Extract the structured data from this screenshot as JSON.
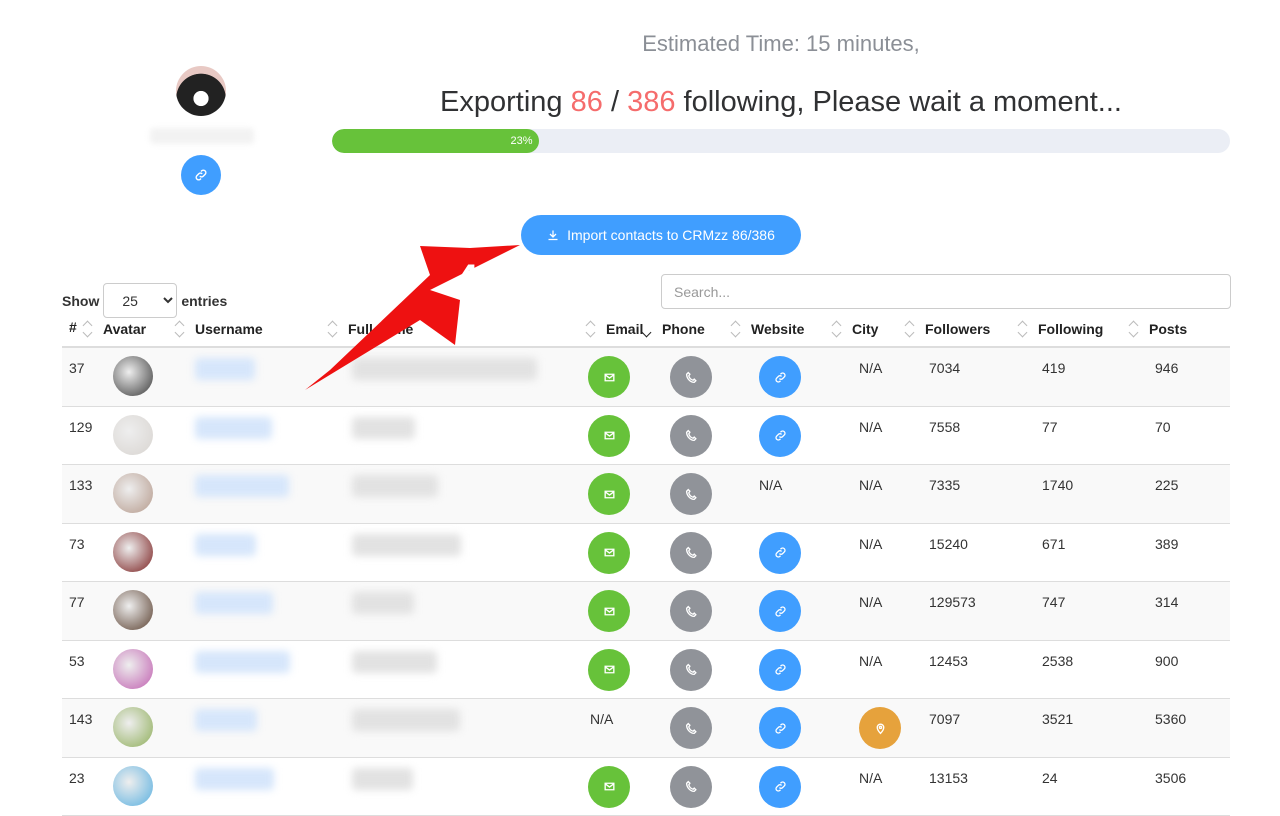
{
  "header": {
    "estimated_time": "Estimated Time: 15 minutes,",
    "exporting_prefix": "Exporting",
    "current": "86",
    "sep": "/",
    "total": "386",
    "exporting_suffix": "following, Please wait a moment...",
    "progress_percent": 23,
    "progress_label": "23%"
  },
  "import_button": {
    "label": "Import contacts to CRMzz 86/386",
    "icon": "download-icon"
  },
  "annotation": {
    "step": "4"
  },
  "controls": {
    "show_label": "Show",
    "entries_value": "25",
    "entries_label": "entries",
    "search_placeholder": "Search..."
  },
  "columns": [
    "#",
    "Avatar",
    "Username",
    "Full name",
    "Email",
    "Phone",
    "Website",
    "City",
    "Followers",
    "Following",
    "Posts"
  ],
  "sorted_column": "Phone",
  "rows": [
    {
      "id": "37",
      "email": true,
      "phone": true,
      "website": true,
      "city": "N/A",
      "followers": "7034",
      "following": "419",
      "posts": "946",
      "avatar_color": "#3a3a3a"
    },
    {
      "id": "129",
      "email": true,
      "phone": true,
      "website": true,
      "city": "N/A",
      "followers": "7558",
      "following": "77",
      "posts": "70",
      "avatar_color": "#d8d4d0"
    },
    {
      "id": "133",
      "email": true,
      "phone": true,
      "website": false,
      "website_text": "N/A",
      "city": "N/A",
      "followers": "7335",
      "following": "1740",
      "posts": "225",
      "avatar_color": "#b59a8c"
    },
    {
      "id": "73",
      "email": true,
      "phone": true,
      "website": true,
      "city": "N/A",
      "followers": "15240",
      "following": "671",
      "posts": "389",
      "avatar_color": "#7a2020"
    },
    {
      "id": "77",
      "email": true,
      "phone": true,
      "website": true,
      "city": "N/A",
      "followers": "129573",
      "following": "747",
      "posts": "314",
      "avatar_color": "#5a4030"
    },
    {
      "id": "53",
      "email": true,
      "phone": true,
      "website": true,
      "city": "N/A",
      "followers": "12453",
      "following": "2538",
      "posts": "900",
      "avatar_color": "#c060b0"
    },
    {
      "id": "143",
      "email": false,
      "email_text": "N/A",
      "phone": true,
      "website": true,
      "city_icon": true,
      "followers": "7097",
      "following": "3521",
      "posts": "5360",
      "avatar_color": "#8fae5a"
    },
    {
      "id": "23",
      "email": true,
      "phone": true,
      "website": true,
      "city": "N/A",
      "followers": "13153",
      "following": "24",
      "posts": "3506",
      "avatar_color": "#5ab0e0"
    }
  ],
  "colors": {
    "primary": "#409eff",
    "success": "#67c23a",
    "gray": "#909399",
    "warning": "#e6a23c",
    "highlight": "#f56c6c",
    "annotation": "#ee1111"
  }
}
